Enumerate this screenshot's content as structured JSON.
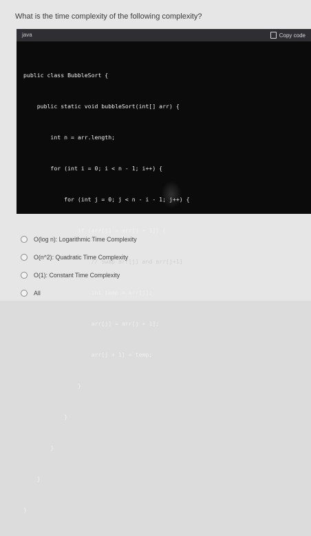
{
  "question": "What is the time complexity of the following complexity?",
  "code_block": {
    "language": "java",
    "copy_label": "Copy code",
    "lines": [
      "public class BubbleSort {",
      "    public static void bubbleSort(int[] arr) {",
      "        int n = arr.length;",
      "        for (int i = 0; i < n - 1; i++) {",
      "            for (int j = 0; j < n - i - 1; j++) {",
      "                if (arr[j] > arr[j + 1]) {",
      "                    // Swap arr[j] and arr[j+1]",
      "                    int temp = arr[j];",
      "                    arr[j] = arr[j + 1];",
      "                    arr[j + 1] = temp;",
      "                }",
      "            }",
      "        }",
      "    }",
      "}"
    ]
  },
  "options": [
    {
      "label": "O(log n): Logarithmic Time Complexity"
    },
    {
      "label": "O(n^2): Quadratic Time Complexity"
    },
    {
      "label": "O(1): Constant Time Complexity"
    },
    {
      "label": "All"
    }
  ]
}
